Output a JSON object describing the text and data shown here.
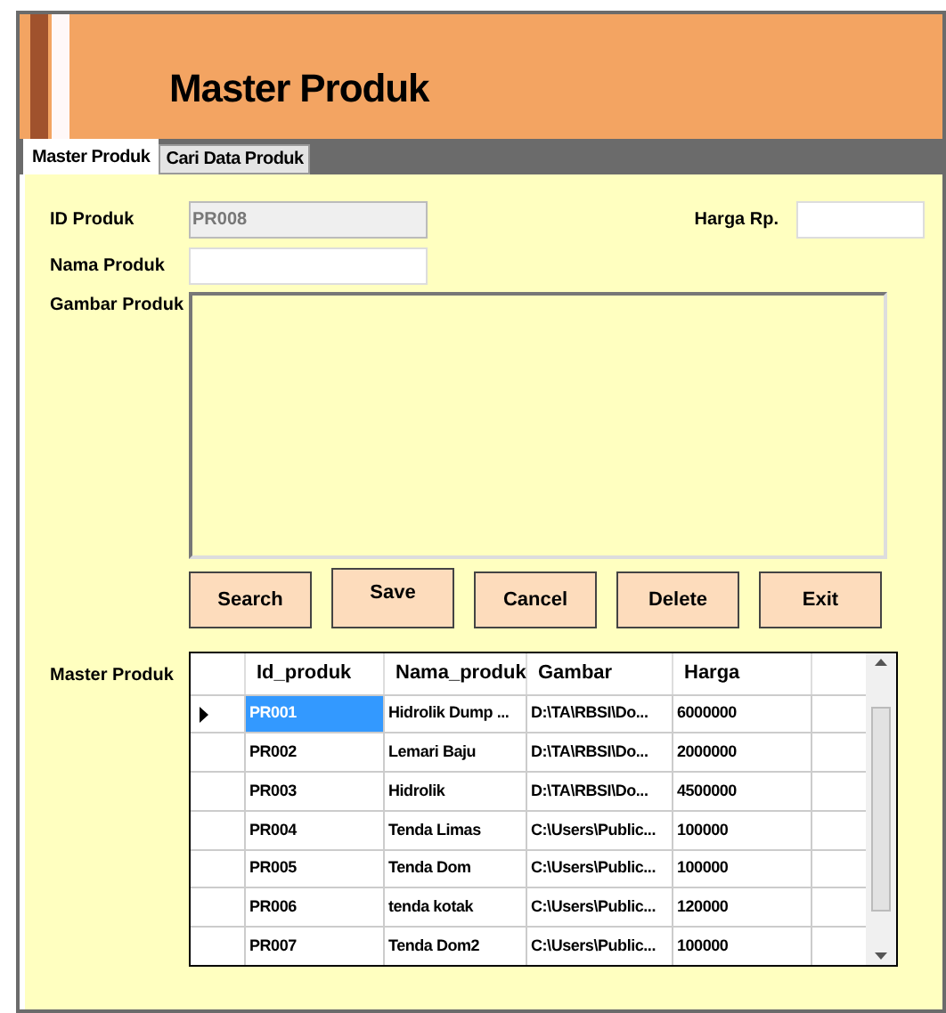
{
  "header": {
    "title": "Master Produk"
  },
  "tabs": [
    {
      "label": "Master Produk",
      "selected": true
    },
    {
      "label": "Cari Data Produk",
      "selected": false
    }
  ],
  "form": {
    "id_label": "ID Produk",
    "id_value": "PR008",
    "name_label": "Nama Produk",
    "price_label": "Harga Rp.",
    "image_label": "Gambar Produk",
    "grid_label": "Master Produk"
  },
  "buttons": [
    "Search",
    "Save",
    "Cancel",
    "Delete",
    "Exit"
  ],
  "table": {
    "columns": [
      "Id_produk",
      "Nama_produk",
      "Gambar",
      "Harga"
    ],
    "rows": [
      {
        "cells": [
          "PR001",
          "Hidrolik Dump ...",
          "D:\\TA\\RBSI\\Do...",
          "6000000"
        ],
        "selected": true
      },
      {
        "cells": [
          "PR002",
          "Lemari Baju",
          "D:\\TA\\RBSI\\Do...",
          "2000000"
        ],
        "selected": false
      },
      {
        "cells": [
          "PR003",
          "Hidrolik",
          "D:\\TA\\RBSI\\Do...",
          "4500000"
        ],
        "selected": false
      },
      {
        "cells": [
          "PR004",
          "Tenda Limas",
          "C:\\Users\\Public...",
          "100000"
        ],
        "selected": false
      },
      {
        "cells": [
          "PR005",
          "Tenda Dom",
          "C:\\Users\\Public...",
          "100000"
        ],
        "selected": false
      },
      {
        "cells": [
          "PR006",
          "tenda kotak",
          "C:\\Users\\Public...",
          "120000"
        ],
        "selected": false
      },
      {
        "cells": [
          "PR007",
          "Tenda Dom2",
          "C:\\Users\\Public...",
          "100000"
        ],
        "selected": false
      }
    ]
  }
}
